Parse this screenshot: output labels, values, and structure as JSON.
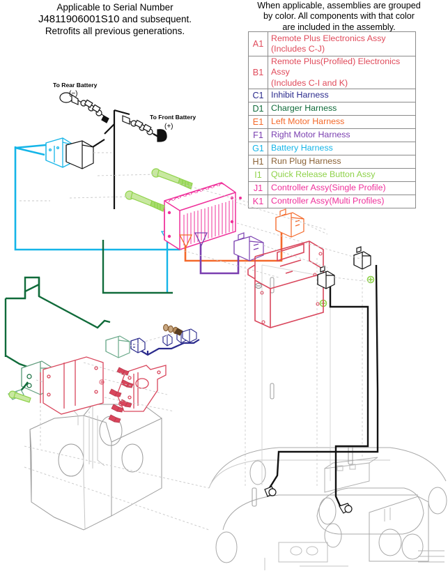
{
  "serial_note": {
    "line1": "Applicable to Serial Number",
    "line2_bold": "J4811906001S10",
    "line2_rest": " and subsequent.",
    "line3": "Retrofits all previous generations."
  },
  "legend": {
    "caption_line1": "When applicable, assemblies are grouped",
    "caption_line2": "by color. All components with that color",
    "caption_line3": "are included in the assembly.",
    "rows": [
      {
        "code": "A1",
        "desc1": "Remote Plus Electronics Assy",
        "desc2": "(Includes C-J)",
        "color": "#e04a5a"
      },
      {
        "code": "B1",
        "desc1": "Remote Plus(Profiled) Electronics Assy",
        "desc2": "(Includes C-I and K)",
        "color": "#e04a5a"
      },
      {
        "code": "C1",
        "desc1": "Inhibit Harness",
        "desc2": "",
        "color": "#2a2a8c"
      },
      {
        "code": "D1",
        "desc1": "Charger Harness",
        "desc2": "",
        "color": "#106b3a"
      },
      {
        "code": "E1",
        "desc1": "Left Motor Harness",
        "desc2": "",
        "color": "#f4692a"
      },
      {
        "code": "F1",
        "desc1": "Right Motor Harness",
        "desc2": "",
        "color": "#7a3fb0"
      },
      {
        "code": "G1",
        "desc1": "Battery Harness",
        "desc2": "",
        "color": "#15b5e8"
      },
      {
        "code": "H1",
        "desc1": "Run Plug Harness",
        "desc2": "",
        "color": "#8a6236"
      },
      {
        "code": "I1",
        "desc1": "Quick Release Button Assy",
        "desc2": "",
        "color": "#8fd24a"
      },
      {
        "code": "J1",
        "desc1": "Controller Assy(Single Profile)",
        "desc2": "",
        "color": "#ef2f9a"
      },
      {
        "code": "K1",
        "desc1": "Controller Assy(Multi Profiles)",
        "desc2": "",
        "color": "#ef2f9a"
      }
    ]
  },
  "drawing": {
    "callouts": {
      "rear_battery_line1": "To Rear Battery",
      "rear_battery_line2": "(−)",
      "front_battery_line1": "To Front Battery",
      "front_battery_line2": "(+)"
    },
    "colors": {
      "battery_harness": "#15b5e8",
      "charger_harness": "#106b3a",
      "inhibit_harness": "#2a2a8c",
      "left_motor": "#f4692a",
      "right_motor": "#7a3fb0",
      "run_plug": "#8a6236",
      "quick_release": "#8fd24a",
      "controller": "#ef2f9a",
      "bracket_red": "#d9465c",
      "chassis_gray": "#b9b9b9",
      "cable_black": "#111111"
    }
  }
}
